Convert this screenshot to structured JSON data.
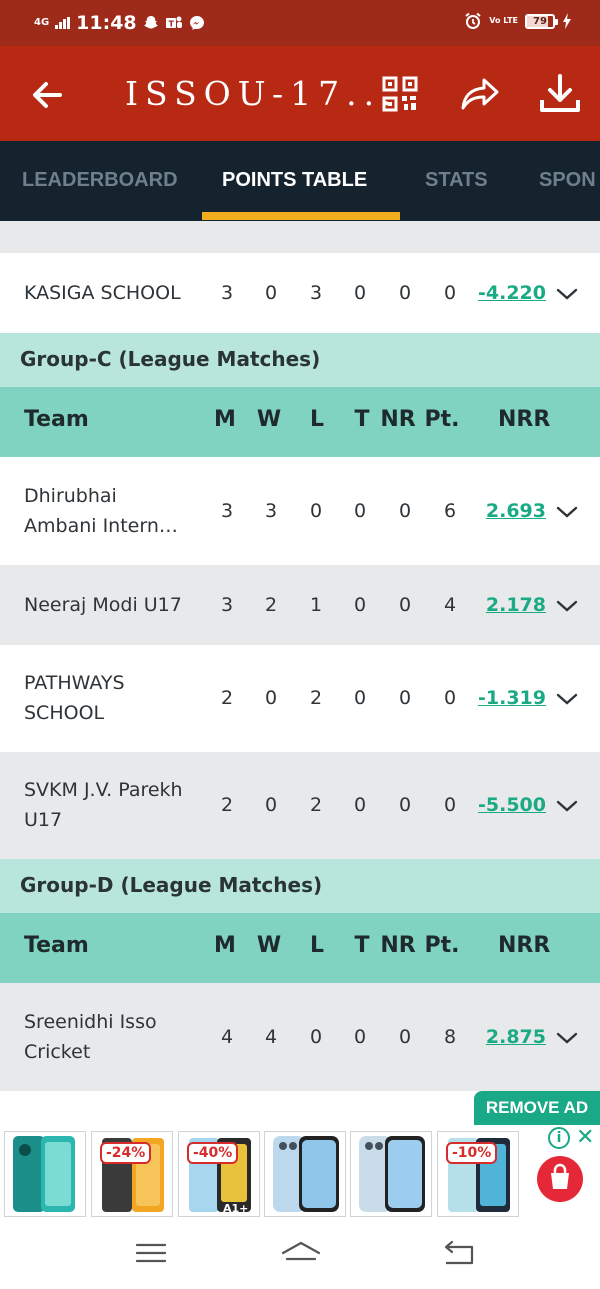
{
  "status_bar": {
    "network": "4G",
    "time": "11:48",
    "volte": "Vo LTE",
    "battery_level": "79",
    "battery_fraction": 0.79,
    "icons": [
      "snapchat-icon",
      "teams-icon",
      "messenger-icon",
      "alarm-icon",
      "charging-icon"
    ]
  },
  "app_bar": {
    "title": "ISSOU-17...",
    "color": "#b82914",
    "icons": [
      "back-arrow-icon",
      "qr-code-icon",
      "share-icon",
      "download-icon"
    ]
  },
  "tabs": {
    "items": [
      "LEADERBOARD",
      "POINTS TABLE",
      "STATS",
      "SPON"
    ],
    "active": "POINTS TABLE",
    "indicator_color": "#f2ad1e"
  },
  "top_row": {
    "team": "KASIGA SCHOOL",
    "m": "3",
    "w": "0",
    "l": "3",
    "t": "0",
    "nr": "0",
    "pt": "0",
    "nrr": "-4.220"
  },
  "group_c": {
    "title": "Group-C (League Matches)",
    "headers": {
      "team": "Team",
      "m": "M",
      "w": "W",
      "l": "L",
      "t": "T",
      "nr": "NR",
      "pt": "Pt.",
      "nrr": "NRR"
    },
    "rows": [
      {
        "team_line1": "Dhirubhai",
        "team_line2": "Ambani Intern…",
        "m": "3",
        "w": "3",
        "l": "0",
        "t": "0",
        "nr": "0",
        "pt": "6",
        "nrr": "2.693"
      },
      {
        "team_line1": "Neeraj Modi U17",
        "team_line2": "",
        "m": "3",
        "w": "2",
        "l": "1",
        "t": "0",
        "nr": "0",
        "pt": "4",
        "nrr": "2.178"
      },
      {
        "team_line1": "PATHWAYS",
        "team_line2": "SCHOOL",
        "m": "2",
        "w": "0",
        "l": "2",
        "t": "0",
        "nr": "0",
        "pt": "0",
        "nrr": "-1.319"
      },
      {
        "team_line1": "SVKM J.V. Parekh",
        "team_line2": "U17",
        "m": "2",
        "w": "0",
        "l": "2",
        "t": "0",
        "nr": "0",
        "pt": "0",
        "nrr": "-5.500"
      }
    ]
  },
  "group_d": {
    "title": "Group-D (League Matches)",
    "headers": {
      "team": "Team",
      "m": "M",
      "w": "W",
      "l": "L",
      "t": "T",
      "nr": "NR",
      "pt": "Pt.",
      "nrr": "NRR"
    },
    "rows": [
      {
        "team_line1": "Sreenidhi Isso",
        "team_line2": "Cricket",
        "m": "4",
        "w": "4",
        "l": "0",
        "t": "0",
        "nr": "0",
        "pt": "8",
        "nrr": "2.875"
      }
    ]
  },
  "ad": {
    "remove_label": "REMOVE AD",
    "discounts": [
      "-24%",
      "-40%",
      "-10%"
    ],
    "info_label": "i",
    "close_label": "✕"
  },
  "colors": {
    "group_header_bg": "#b8e6dc",
    "column_header_bg": "#7fd3c0",
    "nrr_link": "#1aaa84",
    "row_alt_bg": "#e8e9eb"
  }
}
